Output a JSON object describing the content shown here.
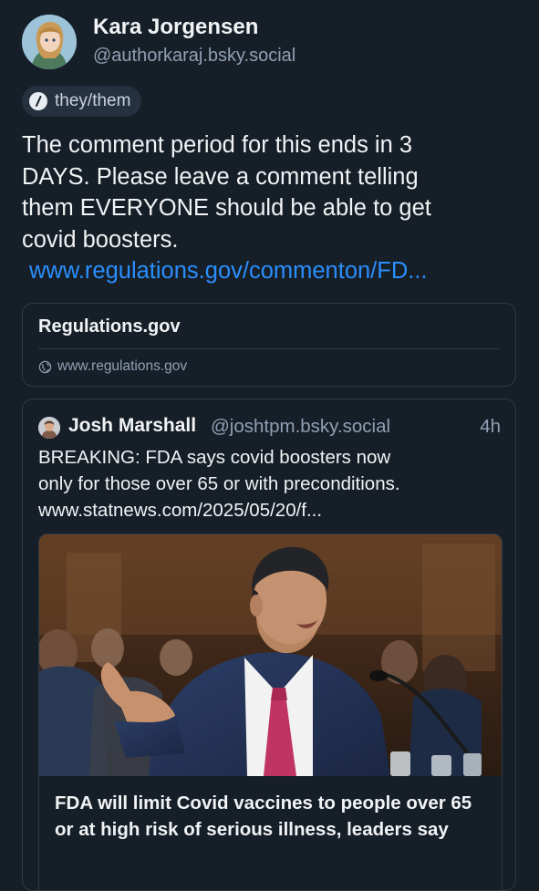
{
  "author": {
    "name": "Kara Jorgensen",
    "handle": "@authorkaraj.bsky.social",
    "pronouns": "they/them"
  },
  "post": {
    "text_lines": [
      "The comment period for this ends in 3",
      "DAYS. Please leave a comment telling",
      "them EVERYONE should be able to get",
      "covid boosters."
    ],
    "link": "www.regulations.gov/commenton/FD..."
  },
  "link_card": {
    "title": "Regulations.gov",
    "domain": "www.regulations.gov"
  },
  "quoted_post": {
    "name": "Josh Marshall",
    "handle": "@joshtpm.bsky.social",
    "time": "4h",
    "text_lines": [
      "BREAKING: FDA says covid boosters now",
      "only for those over 65 or with preconditions.",
      "www.statnews.com/2025/05/20/f..."
    ],
    "embed": {
      "title": "FDA will limit Covid vaccines to people over 65 or at high risk of serious illness, leaders say"
    }
  },
  "colors": {
    "background": "#161e27",
    "link": "#2a8ffd",
    "muted_text": "#8fa0b3",
    "border": "#2e3a48"
  },
  "icons": {
    "pronoun_pill": "info-slash-icon",
    "link_card_domain": "globe-icon"
  }
}
